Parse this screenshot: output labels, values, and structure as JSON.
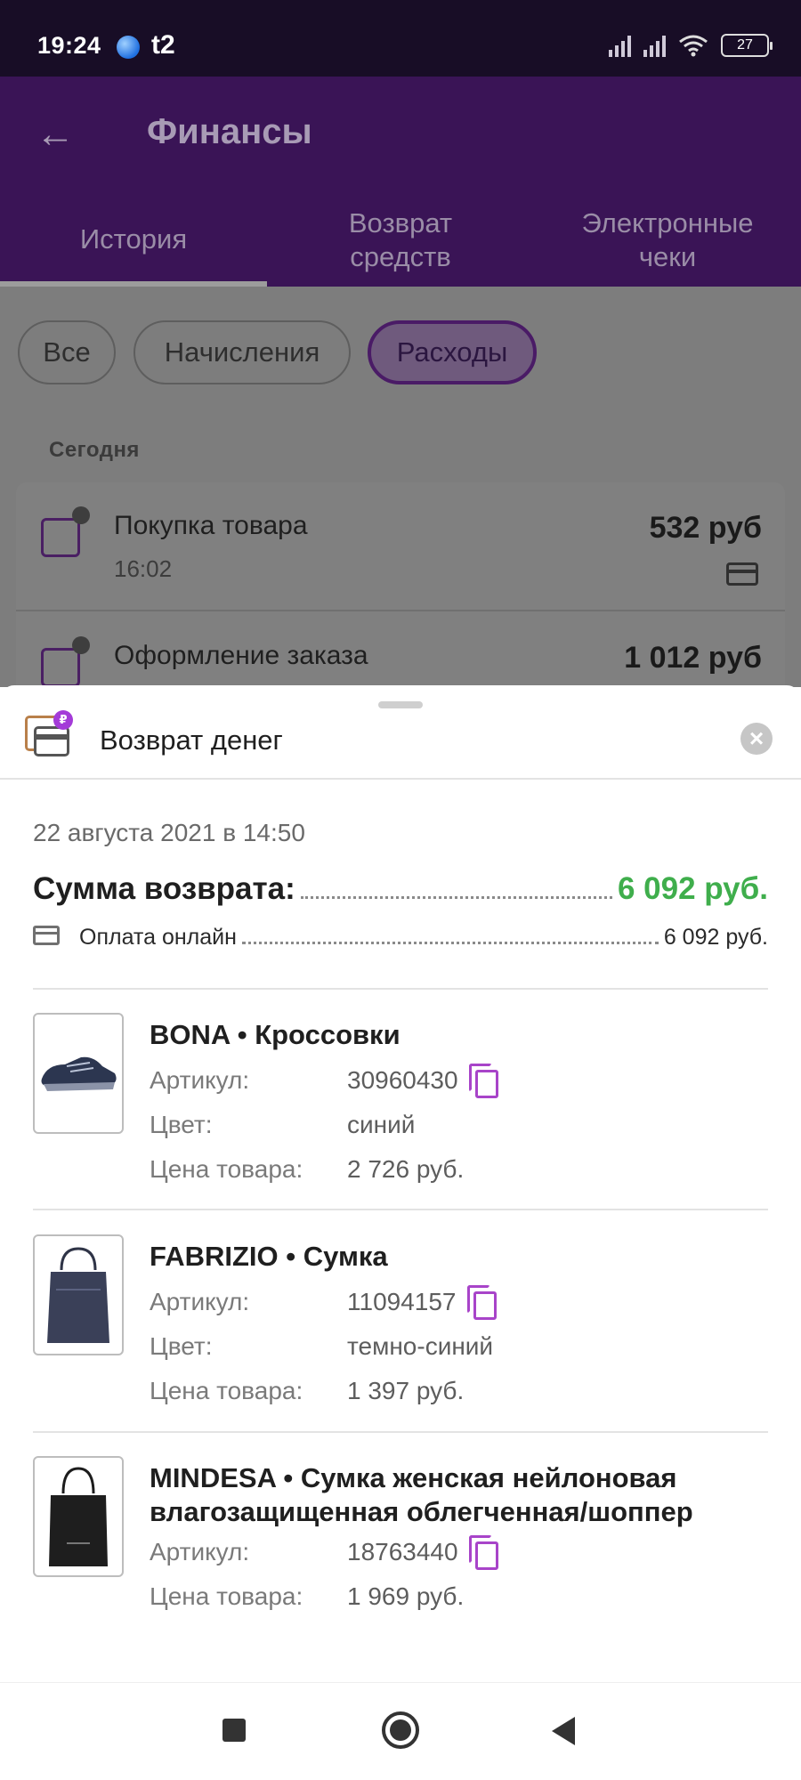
{
  "status_bar": {
    "time": "19:24",
    "carrier": "t2",
    "battery": "27"
  },
  "app_bar": {
    "title": "Финансы",
    "back_icon": "arrow-left-icon"
  },
  "tabs": [
    {
      "label": "История",
      "active": true
    },
    {
      "label": "Возврат\nсредств",
      "active": false
    },
    {
      "label": "Электронные\nчеки",
      "active": false
    }
  ],
  "filters": [
    {
      "label": "Все",
      "active": false
    },
    {
      "label": "Начисления",
      "active": false
    },
    {
      "label": "Расходы",
      "active": true
    }
  ],
  "history": {
    "date_header": "Сегодня",
    "transactions": [
      {
        "title": "Покупка товара",
        "time": "16:02",
        "amount": "532 руб",
        "icon": "package-icon"
      },
      {
        "title": "Оформление заказа",
        "time": "",
        "amount": "1 012 руб",
        "icon": "package-icon"
      }
    ]
  },
  "sheet": {
    "title": "Возврат денег",
    "date": "22 августа 2021 в 14:50",
    "sum_label": "Сумма возврата:",
    "sum_value": "6 092 руб.",
    "payment_label": "Оплата онлайн",
    "payment_value": "6 092 руб.",
    "accent_color": "#a844c9",
    "sum_color": "#3fae4c"
  },
  "labels": {
    "article": "Артикул:",
    "color": "Цвет:",
    "price": "Цена товара:"
  },
  "products": [
    {
      "name": "BONA • Кроссовки",
      "article": "30960430",
      "color": "синий",
      "price": "2 726 руб.",
      "thumb": "sneakers-image"
    },
    {
      "name": "FABRIZIO • Сумка",
      "article": "11094157",
      "color": "темно-синий",
      "price": "1 397 руб.",
      "thumb": "bag-image"
    },
    {
      "name": "MINDESA • Сумка женская нейлоновая влагозащищенная облегченная/шоппер",
      "article": "18763440",
      "price": "1 969 руб.",
      "thumb": "shopper-bag-image"
    }
  ]
}
